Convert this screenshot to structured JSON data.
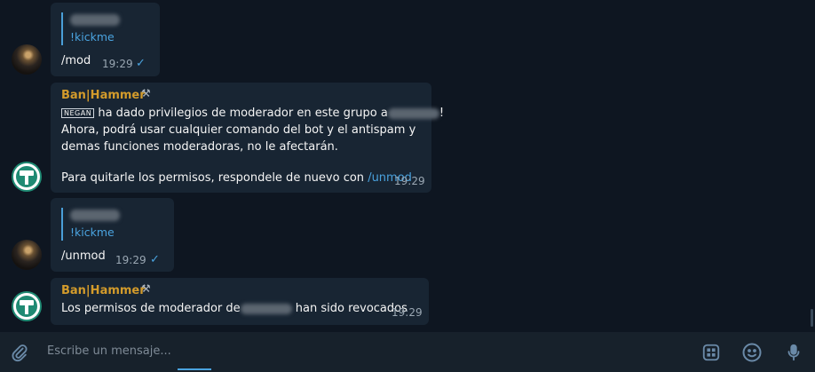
{
  "messages": {
    "m1": {
      "quote_text": "!kickme",
      "text": "/mod",
      "time": "19:29",
      "status": "✓"
    },
    "m2": {
      "sender": "Ban|Hammer",
      "admin_label": "NEGAN",
      "line1": " ha dado privilegios de moderador en este grupo a",
      "line1_end": "!",
      "line2": "Ahora, podrá usar cualquier comando del bot y el antispam y",
      "line3": "demas funciones moderadoras, no le afectarán.",
      "line4": "Para quitarle los permisos, respondele de nuevo con ",
      "command": "/unmod",
      "time": "19:29"
    },
    "m3": {
      "quote_text": "!kickme",
      "text": "/unmod",
      "time": "19:29",
      "status": "✓"
    },
    "m4": {
      "sender": "Ban|Hammer",
      "text_before": "Los permisos de moderador de",
      "text_after": " han sido revocados",
      "time": "19:29"
    }
  },
  "input": {
    "placeholder": "Escribe un mensaje..."
  },
  "icons": {
    "attach": "paperclip-icon",
    "bot_commands": "bot-commands-icon",
    "emoji": "emoji-icon",
    "voice": "microphone-icon",
    "hammer": "hammer-icon"
  },
  "colors": {
    "background": "#0e1621",
    "bubble": "#182533",
    "accent": "#4aa3df",
    "sender": "#d39b2b"
  }
}
